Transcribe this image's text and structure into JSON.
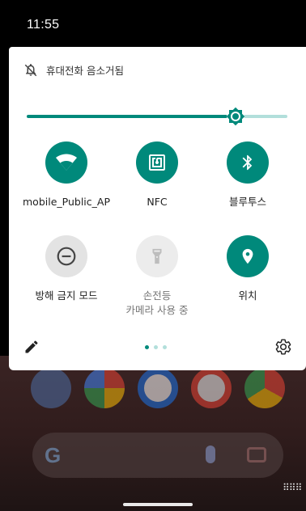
{
  "status_bar": {
    "time": "11:55"
  },
  "quick_settings": {
    "mute_status": "휴대전화 음소거됨",
    "brightness": {
      "level_fraction": 0.8
    },
    "tiles": [
      {
        "label": "mobile_Public_AP",
        "state": "on",
        "icon": "wifi-icon"
      },
      {
        "label": "NFC",
        "state": "on",
        "icon": "nfc-icon"
      },
      {
        "label": "블루투스",
        "state": "on",
        "icon": "bluetooth-icon"
      },
      {
        "label": "방해 금지 모드",
        "state": "off",
        "icon": "do-not-disturb-icon"
      },
      {
        "label": "손전등",
        "sublabel": "카메라 사용 중",
        "state": "disabled",
        "icon": "flashlight-icon"
      },
      {
        "label": "위치",
        "state": "on",
        "icon": "location-icon"
      }
    ],
    "page_indicator": {
      "pages": 3,
      "current": 1
    }
  },
  "colors": {
    "accent": "#00897b",
    "accent_light": "#b2dfdb",
    "tile_off": "#e3e3e3"
  }
}
